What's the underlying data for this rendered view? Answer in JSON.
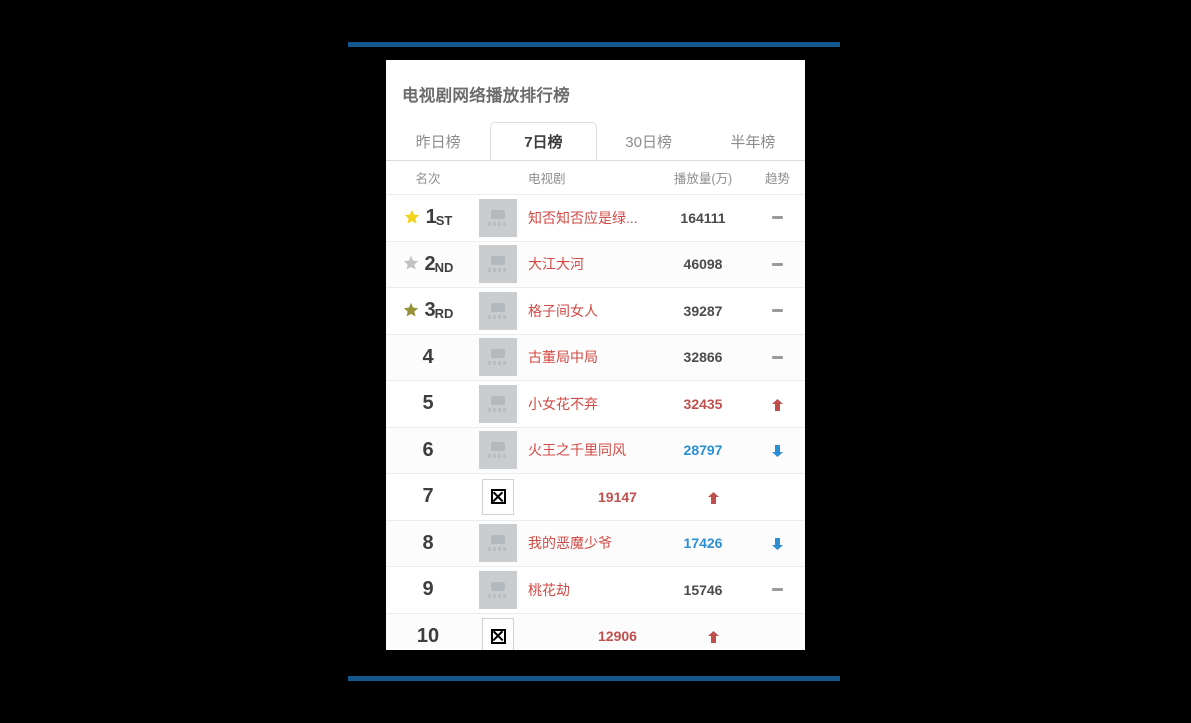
{
  "theme": {
    "rule_color": "#12588f",
    "page_bg": "#000000",
    "card_bg": "#ffffff",
    "title_color": "#6d6d6d",
    "link_color": "#d24a45",
    "up_color": "#c0504d",
    "down_color": "#2a8fd4",
    "flat_color": "#9a9a9a",
    "gold_star": "#f2d21a",
    "silver_star": "#c2c2c2",
    "bronze_star": "#97913a"
  },
  "card": {
    "title": "电视剧网络播放排行榜",
    "tabs": [
      {
        "label": "昨日榜",
        "active": false
      },
      {
        "label": "7日榜",
        "active": true
      },
      {
        "label": "30日榜",
        "active": false
      },
      {
        "label": "半年榜",
        "active": false
      }
    ],
    "columns": {
      "rank": "名次",
      "drama": "电视剧",
      "plays": "播放量(万)",
      "trend": "趋势"
    },
    "rows": [
      {
        "rank": "1",
        "suffix": "ST",
        "medal": "gold",
        "thumb": "placeholder",
        "title": "知否知否应是绿...",
        "plays": "164111",
        "trend": "flat"
      },
      {
        "rank": "2",
        "suffix": "ND",
        "medal": "silver",
        "thumb": "placeholder",
        "title": "大江大河",
        "plays": "46098",
        "trend": "flat"
      },
      {
        "rank": "3",
        "suffix": "RD",
        "medal": "bronze",
        "thumb": "placeholder",
        "title": "格子间女人",
        "plays": "39287",
        "trend": "flat"
      },
      {
        "rank": "4",
        "suffix": "",
        "medal": "none",
        "thumb": "placeholder",
        "title": "古董局中局",
        "plays": "32866",
        "trend": "flat"
      },
      {
        "rank": "5",
        "suffix": "",
        "medal": "none",
        "thumb": "placeholder",
        "title": "小女花不弃",
        "plays": "32435",
        "trend": "up"
      },
      {
        "rank": "6",
        "suffix": "",
        "medal": "none",
        "thumb": "placeholder",
        "title": "火王之千里同风",
        "plays": "28797",
        "trend": "down"
      },
      {
        "rank": "7",
        "suffix": "",
        "medal": "none",
        "thumb": "broken",
        "title": "",
        "plays": "19147",
        "trend": "up"
      },
      {
        "rank": "8",
        "suffix": "",
        "medal": "none",
        "thumb": "placeholder",
        "title": "我的恶魔少爷",
        "plays": "17426",
        "trend": "down"
      },
      {
        "rank": "9",
        "suffix": "",
        "medal": "none",
        "thumb": "placeholder",
        "title": "桃花劫",
        "plays": "15746",
        "trend": "flat"
      },
      {
        "rank": "10",
        "suffix": "",
        "medal": "none",
        "thumb": "broken",
        "title": "",
        "plays": "12906",
        "trend": "up"
      },
      {
        "rank": "",
        "suffix": "",
        "medal": "none",
        "thumb": "placeholder",
        "title": "",
        "plays": "",
        "trend": "none"
      }
    ]
  }
}
